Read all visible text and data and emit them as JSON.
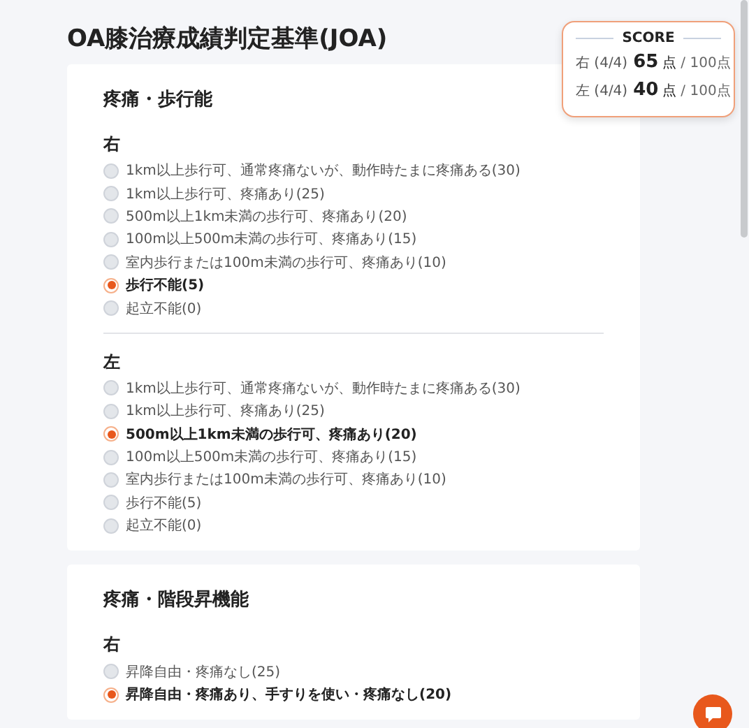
{
  "title": "OA膝治療成績判定基準(JOA)",
  "sections": [
    {
      "title": "疼痛・歩行能",
      "sides": [
        {
          "label": "右",
          "options": [
            {
              "label": "1km以上歩行可、通常疼痛ないが、動作時たまに疼痛ある(30)",
              "selected": false
            },
            {
              "label": "1km以上歩行可、疼痛あり(25)",
              "selected": false
            },
            {
              "label": "500m以上1km未満の歩行可、疼痛あり(20)",
              "selected": false
            },
            {
              "label": "100m以上500m未満の歩行可、疼痛あり(15)",
              "selected": false
            },
            {
              "label": "室内歩行または100m未満の歩行可、疼痛あり(10)",
              "selected": false
            },
            {
              "label": "歩行不能(5)",
              "selected": true
            },
            {
              "label": "起立不能(0)",
              "selected": false
            }
          ]
        },
        {
          "label": "左",
          "options": [
            {
              "label": "1km以上歩行可、通常疼痛ないが、動作時たまに疼痛ある(30)",
              "selected": false
            },
            {
              "label": "1km以上歩行可、疼痛あり(25)",
              "selected": false
            },
            {
              "label": "500m以上1km未満の歩行可、疼痛あり(20)",
              "selected": true
            },
            {
              "label": "100m以上500m未満の歩行可、疼痛あり(15)",
              "selected": false
            },
            {
              "label": "室内歩行または100m未満の歩行可、疼痛あり(10)",
              "selected": false
            },
            {
              "label": "歩行不能(5)",
              "selected": false
            },
            {
              "label": "起立不能(0)",
              "selected": false
            }
          ]
        }
      ]
    },
    {
      "title": "疼痛・階段昇機能",
      "sides": [
        {
          "label": "右",
          "options": [
            {
              "label": "昇降自由・疼痛なし(25)",
              "selected": false
            },
            {
              "label": "昇降自由・疼痛あり、手すりを使い・疼痛なし(20)",
              "selected": true
            }
          ]
        }
      ]
    }
  ],
  "score": {
    "title": "SCORE",
    "rows": [
      {
        "label": "右 (4/4)",
        "value": "65",
        "unit": "点",
        "total": "/ 100点"
      },
      {
        "label": "左 (4/4)",
        "value": "40",
        "unit": "点",
        "total": "/ 100点"
      }
    ]
  }
}
